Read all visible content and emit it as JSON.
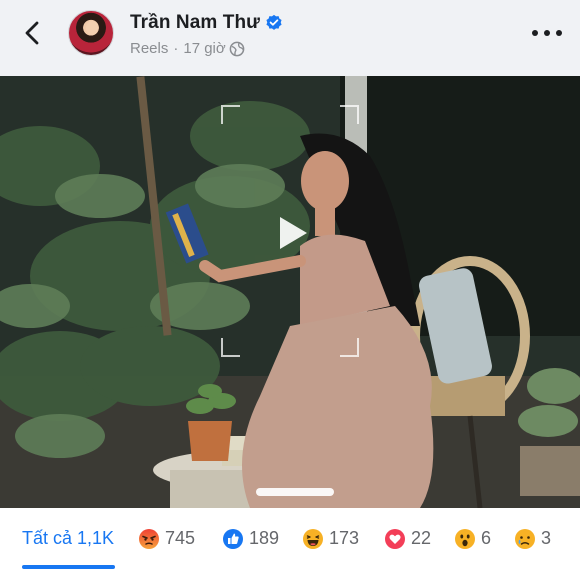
{
  "header": {
    "author_name": "Trần Nam Thư",
    "meta_source": "Reels",
    "meta_separator": "·",
    "meta_time": "17 giờ",
    "icons": {
      "back": "chevron-left-icon",
      "verified": "verified-badge-icon",
      "privacy": "globe-icon",
      "more": "more-horizontal-icon"
    }
  },
  "video": {
    "play_icon": "play-icon"
  },
  "reactions": {
    "all": {
      "label": "Tất cả 1,1K"
    },
    "items": [
      {
        "name": "angry",
        "icon": "angry-emoji-icon",
        "count": "745",
        "color": "#f0533c"
      },
      {
        "name": "like",
        "icon": "like-icon",
        "count": "189",
        "color": "#1877f2"
      },
      {
        "name": "haha",
        "icon": "haha-emoji-icon",
        "count": "173",
        "color": "#f7b125"
      },
      {
        "name": "love",
        "icon": "love-icon",
        "count": "22",
        "color": "#f33e58"
      },
      {
        "name": "wow",
        "icon": "wow-emoji-icon",
        "count": "6",
        "color": "#f7b125"
      },
      {
        "name": "sad",
        "icon": "sad-emoji-icon",
        "count": "3",
        "color": "#f7b125"
      }
    ]
  },
  "colors": {
    "header_bg": "#f0f2f5",
    "accent": "#1877f2",
    "muted_text": "#8a8d91"
  }
}
